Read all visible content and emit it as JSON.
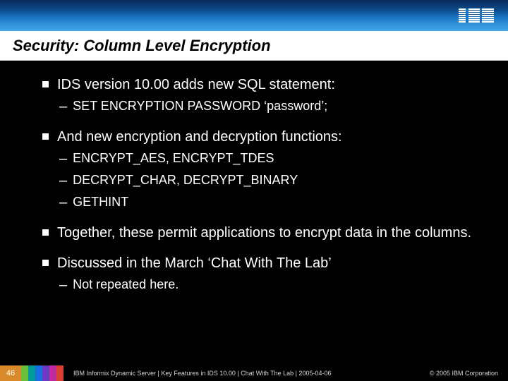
{
  "logo_name": "IBM",
  "title": "Security: Column Level Encryption",
  "bullets": [
    {
      "level": 1,
      "text": "IDS version 10.00 adds new SQL statement:"
    },
    {
      "level": 2,
      "text": "SET ENCRYPTION PASSWORD ‘password’;"
    },
    {
      "level": 1,
      "text": "And new encryption and decryption functions:"
    },
    {
      "level": 2,
      "text": "ENCRYPT_AES, ENCRYPT_TDES"
    },
    {
      "level": 2,
      "text": "DECRYPT_CHAR, DECRYPT_BINARY"
    },
    {
      "level": 2,
      "text": "GETHINT"
    },
    {
      "level": 1,
      "text": "Together, these permit applications to encrypt data in the columns."
    },
    {
      "level": 1,
      "text": "Discussed in the March ‘Chat With The Lab’"
    },
    {
      "level": 2,
      "text": "Not repeated here."
    }
  ],
  "footer": {
    "slide_number": "46",
    "text": "IBM Informix Dynamic Server  |  Key Features in IDS 10.00  |  Chat With The Lab  |  2005-04-06",
    "copyright": "© 2005 IBM Corporation"
  }
}
